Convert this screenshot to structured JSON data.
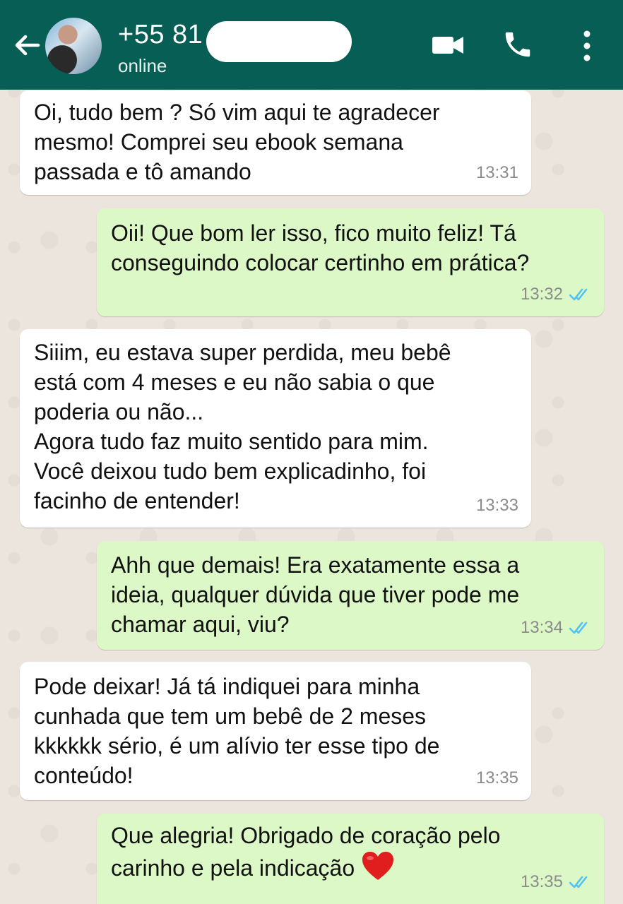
{
  "header": {
    "contact": "+55 81",
    "status": "online",
    "icons": {
      "back": "arrow-left-icon",
      "video": "video-call-icon",
      "call": "phone-call-icon",
      "more": "more-vertical-icon"
    },
    "colors": {
      "bar": "#075e54",
      "incoming": "#ffffff",
      "outgoing": "#dcf8c6",
      "read_ticks": "#4fc3f7"
    }
  },
  "messages": [
    {
      "direction": "in",
      "text": "Oi, tudo bem ? Só vim aqui te agradecer\nmesmo! Comprei seu ebook semana\npassada e tô amando",
      "time": "13:31"
    },
    {
      "direction": "out",
      "text": "Oii! Que bom ler isso, fico muito feliz! Tá\nconseguindo colocar certinho em prática?",
      "time": "13:32",
      "status": "read"
    },
    {
      "direction": "in",
      "text": "Siiim, eu estava super perdida, meu bebê\nestá com 4 meses e eu não sabia o que\npoderia ou não...\nAgora tudo faz muito sentido para mim.\nVocê deixou tudo bem explicadinho, foi\nfacinho de entender!",
      "time": "13:33"
    },
    {
      "direction": "out",
      "text": "Ahh que demais! Era exatamente essa a\nideia, qualquer dúvida que tiver pode me\nchamar aqui, viu?",
      "time": "13:34",
      "status": "read"
    },
    {
      "direction": "in",
      "text": "Pode deixar! Já tá indiquei para minha\ncunhada que tem um bebê de 2 meses\nkkkkkk sério, é um alívio ter esse tipo de\nconteúdo!",
      "time": "13:35"
    },
    {
      "direction": "out",
      "text": "Que alegria! Obrigado de coração pelo\ncarinho e pela indicação",
      "emoji": "red-heart-icon",
      "time": "13:35",
      "status": "read"
    }
  ]
}
